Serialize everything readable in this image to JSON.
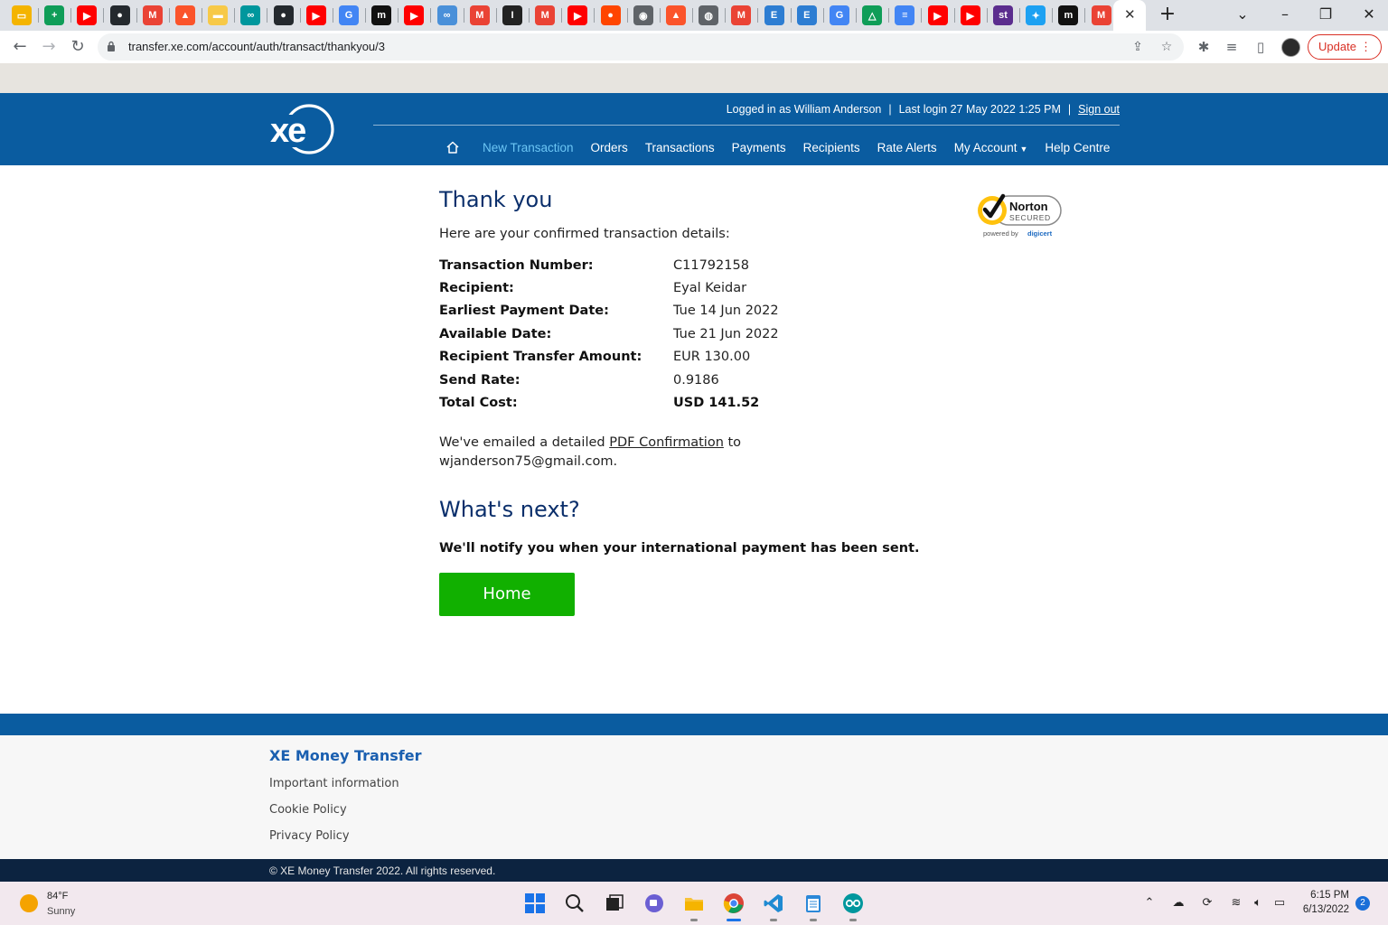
{
  "browser": {
    "url": "transfer.xe.com/account/auth/transact/thankyou/3",
    "update_label": "Update",
    "update_menu": "⋮",
    "tab_close": "✕",
    "new_tab": "+"
  },
  "tabs": [
    {
      "icon": "google-slides-icon",
      "color": "#f4b400"
    },
    {
      "icon": "google-sheets-icon",
      "color": "#0f9d58"
    },
    {
      "icon": "youtube-icon",
      "color": "#ff0000"
    },
    {
      "icon": "github-icon",
      "color": "#24292e"
    },
    {
      "icon": "gmail-icon",
      "color": "#ea4335"
    },
    {
      "icon": "brave-icon",
      "color": "#fb542b"
    },
    {
      "icon": "folder-icon",
      "color": "#f7c948"
    },
    {
      "icon": "arduino-icon",
      "color": "#00979d"
    },
    {
      "icon": "github-icon",
      "color": "#24292e"
    },
    {
      "icon": "youtube-icon",
      "color": "#ff0000"
    },
    {
      "icon": "google-icon",
      "color": "#4285f4"
    },
    {
      "icon": "medium-icon",
      "color": "#111111"
    },
    {
      "icon": "youtube-icon",
      "color": "#ff0000"
    },
    {
      "icon": "app-icon",
      "color": "#4a90d9"
    },
    {
      "icon": "gmail-icon",
      "color": "#ea4335"
    },
    {
      "icon": "instapaper-icon",
      "color": "#222222"
    },
    {
      "icon": "gmail-icon",
      "color": "#ea4335"
    },
    {
      "icon": "youtube-icon",
      "color": "#ff0000"
    },
    {
      "icon": "reddit-icon",
      "color": "#ff4500"
    },
    {
      "icon": "chrome-icon",
      "color": "#5f6368"
    },
    {
      "icon": "brave-icon",
      "color": "#fb542b"
    },
    {
      "icon": "globe-icon",
      "color": "#5f6368"
    },
    {
      "icon": "gmail-icon",
      "color": "#ea4335"
    },
    {
      "icon": "document-icon",
      "color": "#2d7dd2"
    },
    {
      "icon": "document-icon",
      "color": "#2d7dd2"
    },
    {
      "icon": "google-icon",
      "color": "#4285f4"
    },
    {
      "icon": "google-drive-icon",
      "color": "#0f9d58"
    },
    {
      "icon": "google-docs-icon",
      "color": "#4285f4"
    },
    {
      "icon": "youtube-icon",
      "color": "#ff0000"
    },
    {
      "icon": "youtube-icon",
      "color": "#ff0000"
    },
    {
      "icon": "st-icon",
      "color": "#5b2d8e"
    },
    {
      "icon": "twitter-icon",
      "color": "#1da1f2"
    },
    {
      "icon": "medium-icon",
      "color": "#111111"
    },
    {
      "icon": "gmail-icon",
      "color": "#ea4335"
    }
  ],
  "header": {
    "logged_in_text": "Logged in as William Anderson",
    "last_login_text": "Last login 27 May 2022 1:25 PM",
    "sep": "|",
    "sign_out": "Sign out",
    "nav": {
      "new_transaction": "New Transaction",
      "orders": "Orders",
      "transactions": "Transactions",
      "payments": "Payments",
      "recipients": "Recipients",
      "rate_alerts": "Rate Alerts",
      "my_account": "My Account",
      "help_centre": "Help Centre"
    },
    "colors": {
      "brand_blue": "#0a5ca0",
      "active_nav": "#6cc6f5"
    }
  },
  "main": {
    "title": "Thank you",
    "intro": "Here are your confirmed transaction details:",
    "details": [
      {
        "label": "Transaction Number:",
        "value": "C11792158"
      },
      {
        "label": "Recipient:",
        "value": "Eyal Keidar"
      },
      {
        "label": "Earliest Payment Date:",
        "value": "Tue 14 Jun 2022"
      },
      {
        "label": "Available Date:",
        "value": "Tue 21 Jun 2022"
      },
      {
        "label": "Recipient Transfer Amount:",
        "value": "EUR 130.00"
      },
      {
        "label": "Send Rate:",
        "value": "0.9186"
      },
      {
        "label": "Total Cost:",
        "value": "USD 141.52"
      }
    ],
    "email_prefix": "We've emailed a detailed ",
    "pdf_link": "PDF Confirmation",
    "email_to": " to",
    "email_address": "wjanderson75@gmail.com.",
    "whats_next": "What's next?",
    "notify": "We'll notify you when your international payment has been sent.",
    "home_button": "Home",
    "button_color": "#11b000"
  },
  "badge": {
    "norton": "Norton",
    "secured": "SECURED",
    "powered_by": "powered by",
    "digicert": "digicert"
  },
  "footer": {
    "title": "XE Money Transfer",
    "links": [
      "Important information",
      "Cookie Policy",
      "Privacy Policy"
    ],
    "copyright": "© XE Money Transfer 2022. All rights reserved."
  },
  "taskbar": {
    "temperature": "84°F",
    "condition": "Sunny",
    "time": "6:15 PM",
    "date": "6/13/2022",
    "notification_count": "2"
  }
}
